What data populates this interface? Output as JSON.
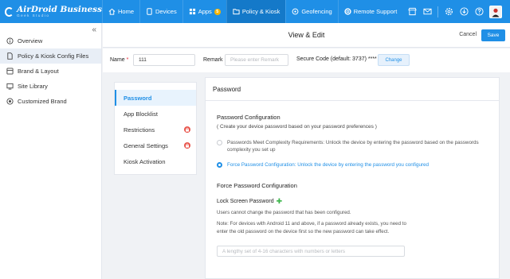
{
  "brand": {
    "title": "AirDroid Business",
    "subtitle": "Geek Studio"
  },
  "nav": {
    "items": [
      {
        "label": "Home",
        "icon": "home-icon"
      },
      {
        "label": "Devices",
        "icon": "devices-icon"
      },
      {
        "label": "Apps",
        "icon": "apps-icon",
        "badge": "5"
      },
      {
        "label": "Policy & Kiosk",
        "icon": "policy-icon",
        "active": true
      },
      {
        "label": "Geofencing",
        "icon": "geofencing-icon"
      },
      {
        "label": "Remote Support",
        "icon": "remote-support-icon"
      }
    ]
  },
  "sidebar": {
    "items": [
      {
        "label": "Overview",
        "icon": "info-icon"
      },
      {
        "label": "Policy & Kiosk Config Files",
        "icon": "file-icon",
        "active": true
      },
      {
        "label": "Brand & Layout",
        "icon": "brand-icon"
      },
      {
        "label": "Site Library",
        "icon": "site-icon"
      },
      {
        "label": "Customized Brand",
        "icon": "brand-custom-icon"
      }
    ]
  },
  "editbar": {
    "title": "View & Edit",
    "cancel": "Cancel",
    "save": "Save"
  },
  "form": {
    "name_label": "Name",
    "name_required": "*",
    "name_value": "111",
    "remark_label": "Remark",
    "remark_placeholder": "Please enter Remark",
    "secure_code": "Secure Code (default: 3737) ****",
    "change_button": "Change"
  },
  "menu": {
    "items": [
      {
        "label": "Password",
        "active": true
      },
      {
        "label": "App Blocklist"
      },
      {
        "label": "Restrictions",
        "locked": true
      },
      {
        "label": "General Settings",
        "locked": true
      },
      {
        "label": "Kiosk Activation"
      }
    ]
  },
  "panel": {
    "title": "Password",
    "config_title": "Password Configuration",
    "config_sub": "( Create your device password based on your password preferences )",
    "option1": "Passwords Meet Complexity Requirements: Unlock the device by entering the password based on the passwords complexity you set up",
    "option2": "Force Password Configuration: Unlock the device by entering the password you configured",
    "force_title": "Force Password Configuration",
    "lock_label": "Lock Screen Password",
    "lock_note": "Users cannot change the password that has been configured.",
    "android_note": "Note: For devices with Android 11 and above, if a password already exists, you need to enter the old password on the device first so the new password can take effect.",
    "password_placeholder": "A lengthy set of 4-16 characters with numbers or letters"
  },
  "colors": {
    "primary": "#1f8fe6",
    "lock_badge": "#e8534a",
    "apps_badge": "#f5b400",
    "plus": "#3bb54a"
  }
}
